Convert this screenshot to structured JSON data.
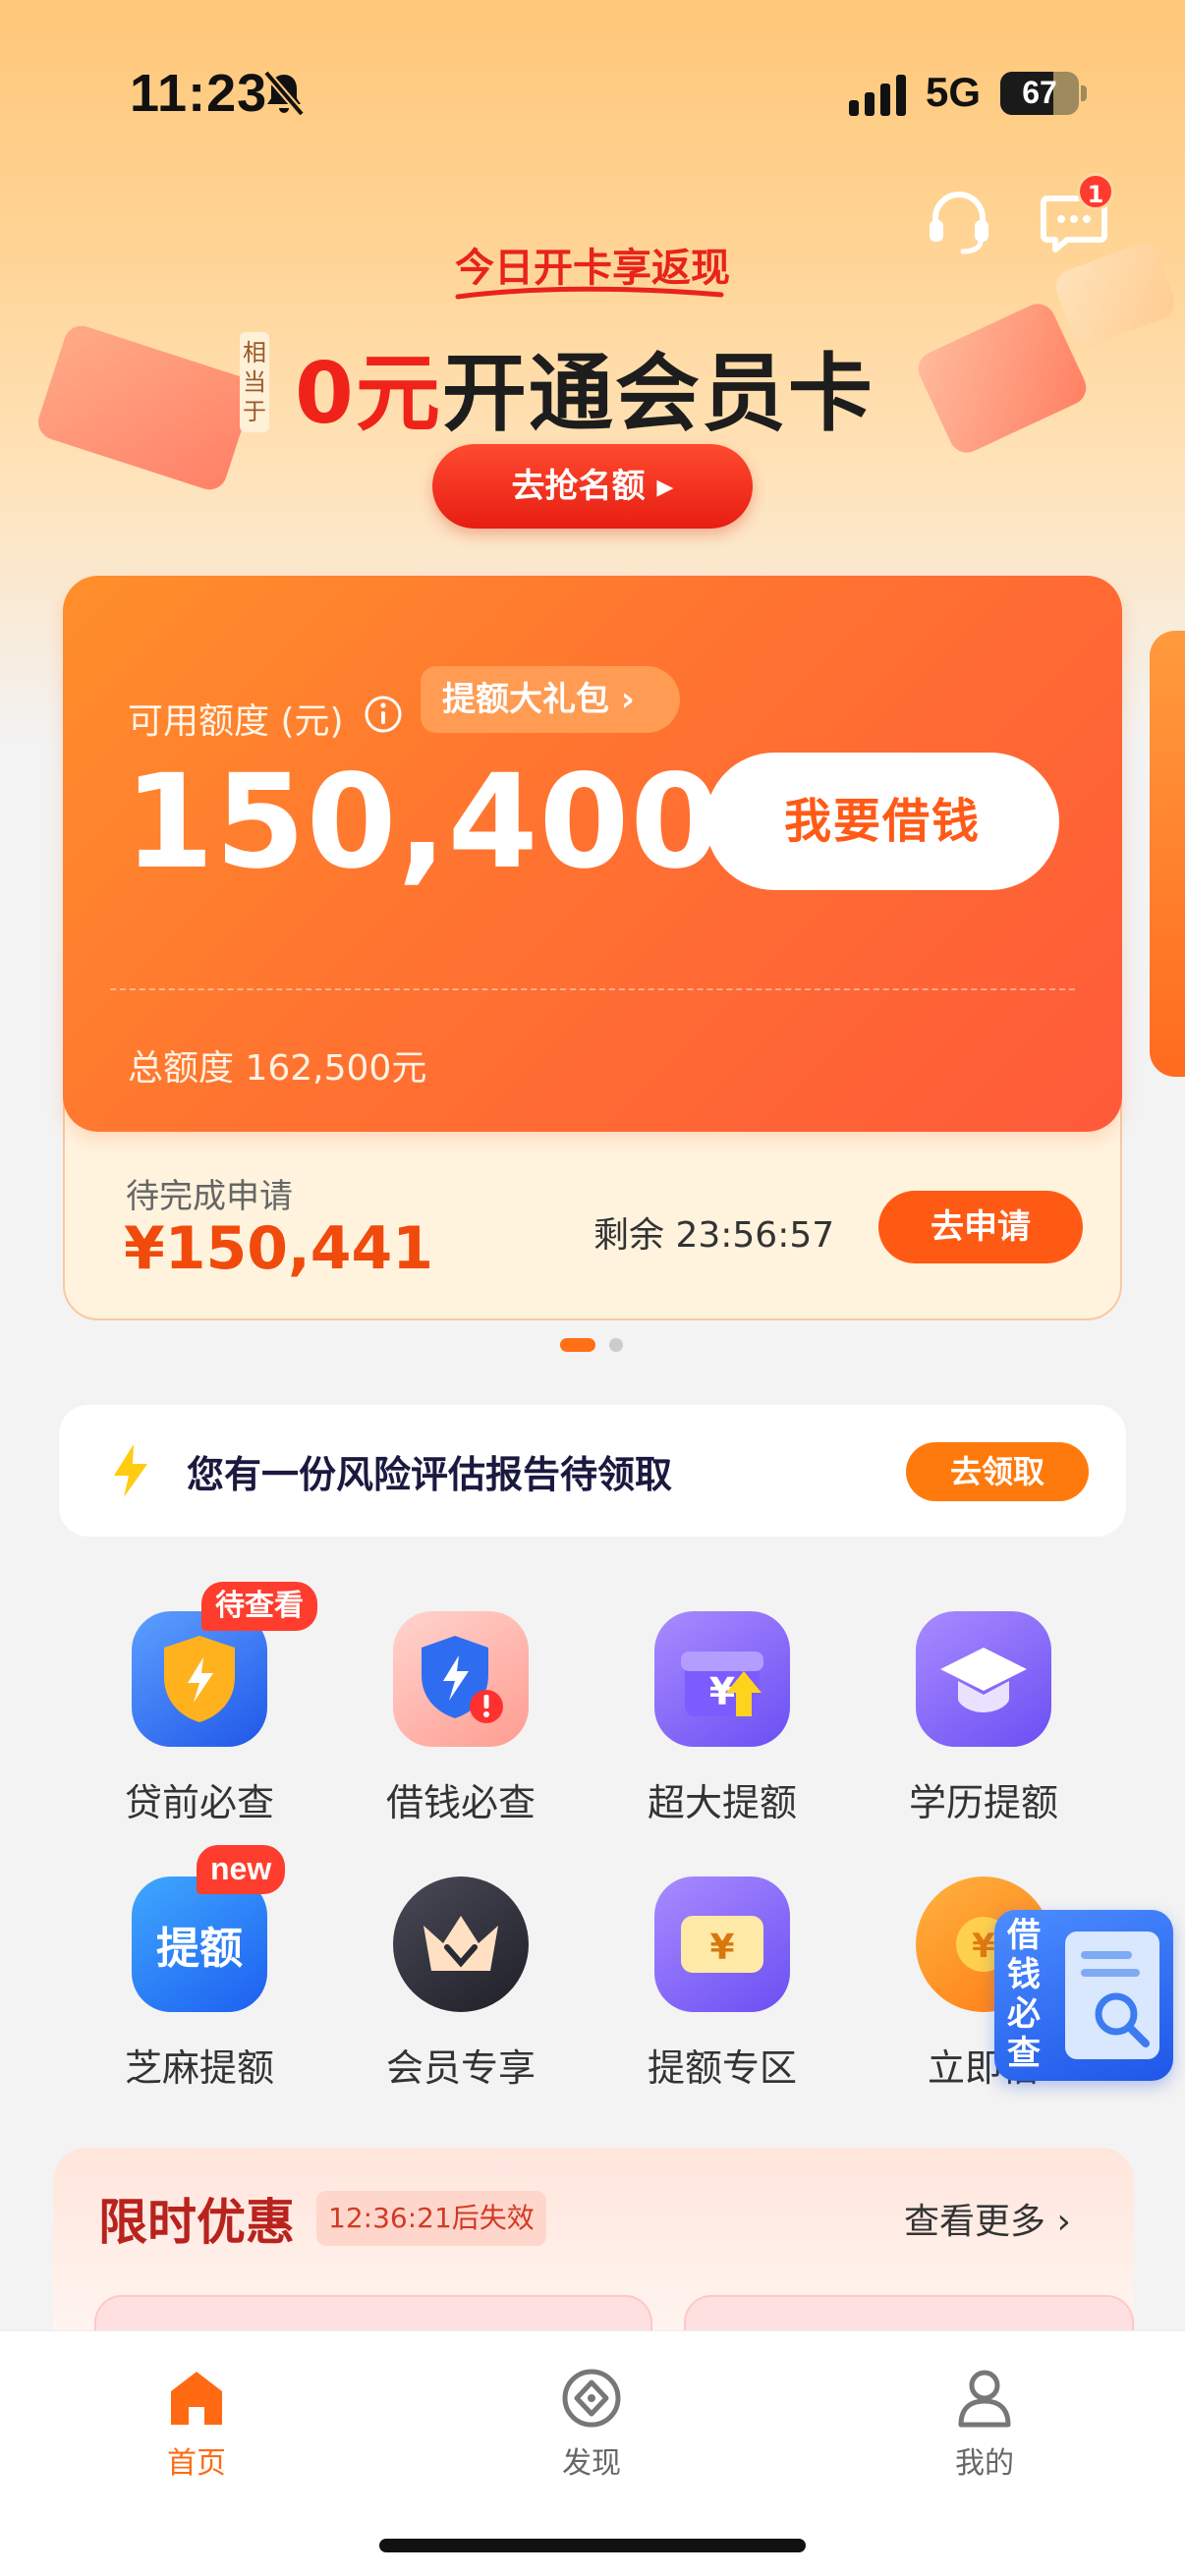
{
  "status_bar": {
    "time": "11:23",
    "network": "5G",
    "battery": "67"
  },
  "header": {
    "message_badge": "1"
  },
  "banner": {
    "subtitle": "今日开卡享返现",
    "side_label": "相当于",
    "title_highlight": "0元",
    "title_rest": "开通会员卡",
    "button": "去抢名额"
  },
  "credit_card": {
    "available_label": "可用额度 (元)",
    "gift_tag": "提额大礼包",
    "available_amount": "150,400",
    "borrow_button": "我要借钱",
    "total_label": "总额度 162,500元",
    "pending_label": "待完成申请",
    "pending_amount": "¥150,441",
    "remaining": "剩余 23:56:57",
    "apply_button": "去申请"
  },
  "risk_report": {
    "text": "您有一份风险评估报告待领取",
    "button": "去领取"
  },
  "grid": {
    "items": [
      {
        "label": "贷前必查",
        "badge": "待查看"
      },
      {
        "label": "借钱必查"
      },
      {
        "label": "超大提额"
      },
      {
        "label": "学历提额"
      },
      {
        "label": "芝麻提额",
        "badge": "new",
        "icon_text": "提额"
      },
      {
        "label": "会员专享"
      },
      {
        "label": "提额专区"
      },
      {
        "label": "立即借"
      }
    ]
  },
  "float_widget": {
    "text": "借钱必查"
  },
  "promo": {
    "title": "限时优惠",
    "timer": "12:36:21后失效",
    "more": "查看更多"
  },
  "tabbar": {
    "accent": "#ff6a13",
    "tabs": [
      {
        "label": "首页"
      },
      {
        "label": "发现"
      },
      {
        "label": "我的"
      }
    ]
  }
}
